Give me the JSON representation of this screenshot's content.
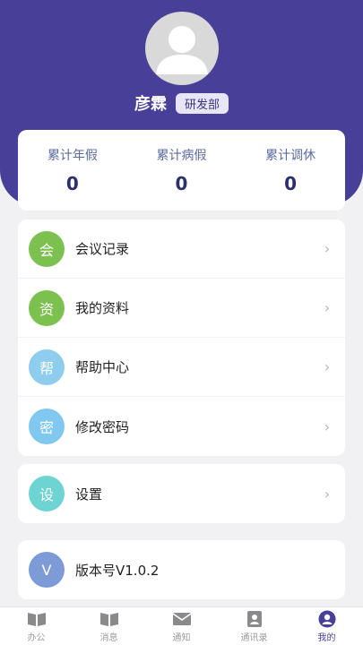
{
  "profile": {
    "name": "彦霖",
    "department": "研发部"
  },
  "stats": [
    {
      "label": "累计年假",
      "value": "0"
    },
    {
      "label": "累计病假",
      "value": "0"
    },
    {
      "label": "累计调休",
      "value": "0"
    }
  ],
  "menu_group_1": [
    {
      "icon_char": "会",
      "label": "会议记录",
      "color": "#7cc14f"
    },
    {
      "icon_char": "资",
      "label": "我的资料",
      "color": "#7cc14f"
    },
    {
      "icon_char": "帮",
      "label": "帮助中心",
      "color": "#8fcdee"
    },
    {
      "icon_char": "密",
      "label": "修改密码",
      "color": "#80c8f0"
    }
  ],
  "settings": {
    "icon_char": "设",
    "label": "设置",
    "color": "#6ed3d3"
  },
  "version": {
    "icon_char": "V",
    "label": "版本号V1.0.2",
    "color": "#7d9bd6"
  },
  "tabs": [
    {
      "label": "办公",
      "icon": "book-icon"
    },
    {
      "label": "消息",
      "icon": "book-icon"
    },
    {
      "label": "通知",
      "icon": "mail-icon"
    },
    {
      "label": "通讯录",
      "icon": "contacts-icon"
    },
    {
      "label": "我的",
      "icon": "user-icon",
      "active": true
    }
  ],
  "colors": {
    "brand": "#473f98",
    "background": "#f1f1f3"
  }
}
